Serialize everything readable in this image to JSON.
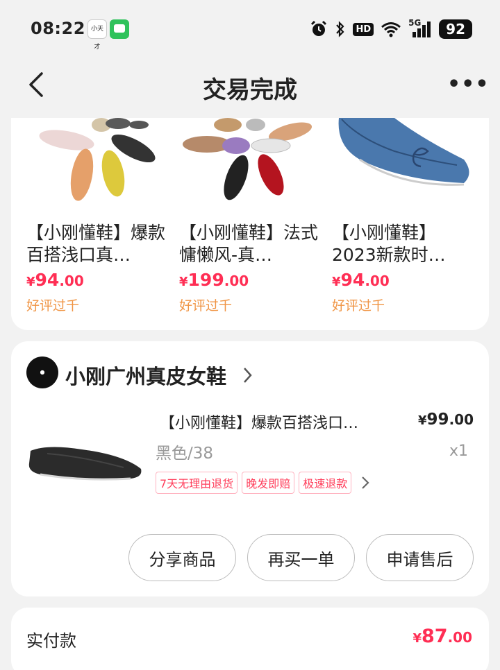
{
  "status_bar": {
    "time": "08:22",
    "app1_label": "小天才",
    "hd": "HD",
    "network": "5G",
    "battery": "92"
  },
  "nav": {
    "title": "交易完成",
    "more": "•••"
  },
  "recommendations": [
    {
      "title": "【小刚懂鞋】爆款百搭浅口真…",
      "price_currency": "¥",
      "price_int": "94",
      "price_dec": ".00",
      "tag": "好评过千"
    },
    {
      "title": "【小刚懂鞋】法式慵懒风-真…",
      "price_currency": "¥",
      "price_int": "199",
      "price_dec": ".00",
      "tag": "好评过千"
    },
    {
      "title": "【小刚懂鞋】2023新款时…",
      "price_currency": "¥",
      "price_int": "94",
      "price_dec": ".00",
      "tag": "好评过千"
    }
  ],
  "order": {
    "shop_name": "小刚广州真皮女鞋",
    "product_title": "【小刚懂鞋】爆款百搭浅口…",
    "price_currency": "¥",
    "price_int": "99",
    "price_dec": ".00",
    "spec": "黑色/38",
    "qty": "x1",
    "service_tags": [
      "7天无理由退货",
      "晚发即赔",
      "极速退款"
    ],
    "buttons": [
      "分享商品",
      "再买一单",
      "申请售后"
    ]
  },
  "payment": {
    "label": "实付款",
    "currency": "¥",
    "amount_int": "87",
    "amount_dec": ".00"
  },
  "colors": {
    "price_red": "#ff2e54",
    "tag_orange": "#f09545",
    "background": "#f2f2f2"
  }
}
